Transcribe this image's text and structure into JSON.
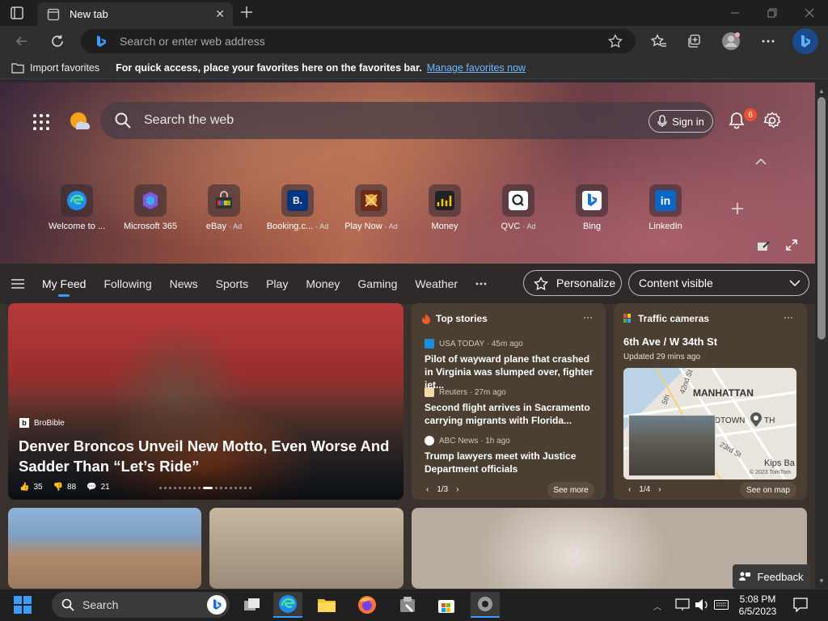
{
  "browser": {
    "tab_title": "New tab",
    "address_placeholder": "Search or enter web address"
  },
  "favorites_bar": {
    "import_label": "Import favorites",
    "tip": "For quick access, place your favorites here on the favorites bar.",
    "manage_link": "Manage favorites now"
  },
  "newtab": {
    "search_placeholder": "Search the web",
    "signin_label": "Sign in",
    "notification_count": "6",
    "quick_links": [
      {
        "label": "Welcome to ...",
        "ad": "",
        "icon": "edge-icon"
      },
      {
        "label": "Microsoft 365",
        "ad": "",
        "icon": "microsoft365-icon"
      },
      {
        "label": "eBay",
        "ad": "· Ad",
        "icon": "ebay-icon"
      },
      {
        "label": "Booking.c...",
        "ad": "· Ad",
        "icon": "booking-icon"
      },
      {
        "label": "Play Now",
        "ad": "· Ad",
        "icon": "play-icon"
      },
      {
        "label": "Money",
        "ad": "",
        "icon": "money-icon"
      },
      {
        "label": "QVC",
        "ad": "· Ad",
        "icon": "qvc-icon"
      },
      {
        "label": "Bing",
        "ad": "",
        "icon": "bing-icon"
      },
      {
        "label": "LinkedIn",
        "ad": "",
        "icon": "linkedin-icon"
      }
    ]
  },
  "feed_nav": {
    "tabs": [
      "My Feed",
      "Following",
      "News",
      "Sports",
      "Play",
      "Money",
      "Gaming",
      "Weather"
    ],
    "personalize": "Personalize",
    "content_visible": "Content visible"
  },
  "big_card": {
    "source": "BroBible",
    "headline": "Denver Broncos Unveil New Motto, Even Worse And Sadder Than “Let’s Ride”",
    "likes": "35",
    "dislikes": "88",
    "comments": "21"
  },
  "top_stories": {
    "title": "Top stories",
    "stories": [
      {
        "source": "USA TODAY · 45m ago",
        "headline": "Pilot of wayward plane that crashed in Virginia was slumped over, fighter jet..."
      },
      {
        "source": "Reuters · 27m ago",
        "headline": "Second flight arrives in Sacramento carrying migrants with Florida..."
      },
      {
        "source": "ABC News · 1h ago",
        "headline": "Trump lawyers meet with Justice Department officials"
      }
    ],
    "pager": "1/3",
    "see_more": "See more"
  },
  "traffic": {
    "title": "Traffic cameras",
    "location": "6th Ave / W 34th St",
    "updated": "Updated 29 mins ago",
    "map_labels": [
      "MANHATTAN",
      "5th",
      "42nd St",
      "IDTOWN",
      "TH",
      "23rd St",
      "Kips Ba"
    ],
    "map_credit": "© 2023 TomTom",
    "pager": "1/4",
    "see_on_map": "See on map"
  },
  "feedback": "Feedback",
  "taskbar": {
    "search": "Search",
    "time": "5:08 PM",
    "date": "6/5/2023"
  },
  "colors": {
    "accent": "#3b9cff",
    "link": "#6fb6ff",
    "badge": "#e8512f"
  }
}
